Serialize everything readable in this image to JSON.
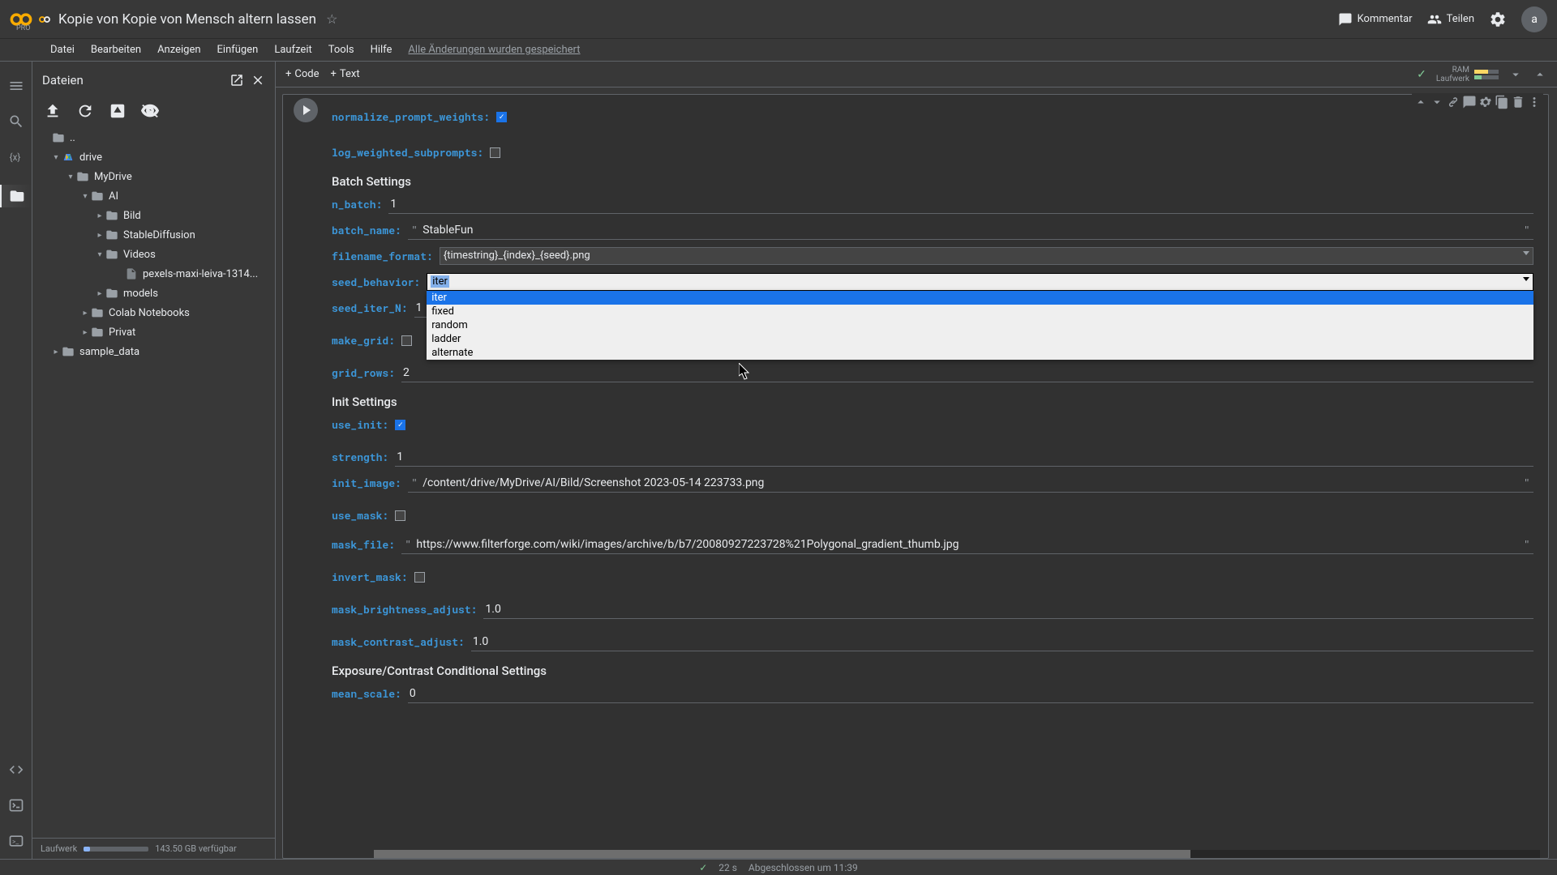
{
  "header": {
    "pro": "PRO",
    "title": "Kopie von Kopie von Mensch altern lassen",
    "kommentar": "Kommentar",
    "teilen": "Teilen",
    "avatar": "a"
  },
  "menu": {
    "items": [
      "Datei",
      "Bearbeiten",
      "Anzeigen",
      "Einfügen",
      "Laufzeit",
      "Tools",
      "Hilfe"
    ],
    "status": "Alle Änderungen wurden gespeichert"
  },
  "filepanel": {
    "title": "Dateien",
    "dotdot": "..",
    "drive": "drive",
    "mydrive": "MyDrive",
    "ai": "AI",
    "bild": "Bild",
    "sd": "StableDiffusion",
    "videos": "Videos",
    "pexels": "pexels-maxi-leiva-1314...",
    "models": "models",
    "colab": "Colab Notebooks",
    "privat": "Privat",
    "sample": "sample_data",
    "footer_label": "Laufwerk",
    "footer_avail": "143.50 GB verfügbar"
  },
  "toolbar": {
    "code": "Code",
    "text": "Text",
    "ram": "RAM",
    "laufwerk": "Laufwerk"
  },
  "form": {
    "normalize_prompt_weights": "normalize_prompt_weights:",
    "log_weighted_subprompts": "log_weighted_subprompts:",
    "batch_settings": "Batch Settings",
    "n_batch": "n_batch:",
    "n_batch_v": "1",
    "batch_name": "batch_name:",
    "batch_name_v": "StableFun",
    "filename_format": "filename_format:",
    "filename_format_v": "{timestring}_{index}_{seed}.png",
    "seed_behavior": "seed_behavior:",
    "seed_behavior_v": "iter",
    "seed_behavior_opts": [
      "iter",
      "fixed",
      "random",
      "ladder",
      "alternate"
    ],
    "seed_iter_n": "seed_iter_N:",
    "seed_iter_n_v": "1",
    "make_grid": "make_grid:",
    "grid_rows": "grid_rows:",
    "grid_rows_v": "2",
    "init_settings": "Init Settings",
    "use_init": "use_init:",
    "strength": "strength:",
    "strength_v": "1",
    "init_image": "init_image:",
    "init_image_v": "/content/drive/MyDrive/AI/Bild/Screenshot 2023-05-14 223733.png",
    "use_mask": "use_mask:",
    "mask_file": "mask_file:",
    "mask_file_v": "https://www.filterforge.com/wiki/images/archive/b/b7/20080927223728%21Polygonal_gradient_thumb.jpg",
    "invert_mask": "invert_mask:",
    "mask_brightness": "mask_brightness_adjust:",
    "mask_brightness_v": "1.0",
    "mask_contrast": "mask_contrast_adjust:",
    "mask_contrast_v": "1.0",
    "exposure_settings": "Exposure/Contrast Conditional Settings",
    "mean_scale": "mean_scale:",
    "mean_scale_v": "0"
  },
  "status": {
    "time": "22 s",
    "done": "Abgeschlossen um 11:39"
  }
}
